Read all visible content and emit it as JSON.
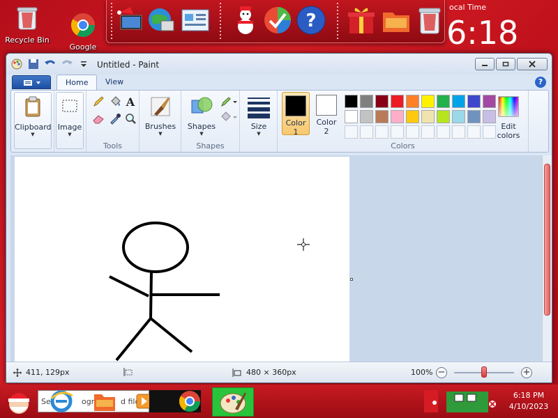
{
  "desktop": {
    "icons": [
      {
        "label": "Recycle Bin"
      },
      {
        "label": "Google"
      }
    ],
    "clock_widget": {
      "label": "ocal Time",
      "time": "6:18"
    }
  },
  "window": {
    "title": "Untitled - Paint",
    "tabs": [
      {
        "label": "Home",
        "active": true
      },
      {
        "label": "View",
        "active": false
      }
    ],
    "help": "?"
  },
  "ribbon": {
    "clipboard": {
      "label": "Clipboard"
    },
    "image": {
      "label": "Image"
    },
    "tools_group": "Tools",
    "brushes": {
      "label": "Brushes"
    },
    "shapes": {
      "label": "Shapes"
    },
    "shapes_group": "Shapes",
    "size": {
      "label": "Size"
    },
    "color1": {
      "label_line1": "Color",
      "label_line2": "1",
      "color": "#000000"
    },
    "color2": {
      "label_line1": "Color",
      "label_line2": "2",
      "color": "#ffffff"
    },
    "edit_colors": {
      "label_line1": "Edit",
      "label_line2": "colors"
    },
    "colors_group": "Colors",
    "palette_row1": [
      "#000000",
      "#7f7f7f",
      "#880015",
      "#ed1c24",
      "#ff7f27",
      "#fff200",
      "#22b14c",
      "#00a2e8",
      "#3f48cc",
      "#a349a4"
    ],
    "palette_row2": [
      "#ffffff",
      "#c3c3c3",
      "#b97a57",
      "#ffaec9",
      "#ffc90e",
      "#efe4b0",
      "#b5e61d",
      "#99d9ea",
      "#7092be",
      "#c8bfe7"
    ]
  },
  "status": {
    "cursor_pos": "411, 129px",
    "canvas_size": "480 × 360px",
    "zoom": "100%",
    "zoom_fraction": 0.5
  },
  "taskbar": {
    "search_text": "Se",
    "search_text_tail": "ogra",
    "search_text_tail2": "d files",
    "time": "6:18 PM",
    "date": "4/10/2023"
  }
}
